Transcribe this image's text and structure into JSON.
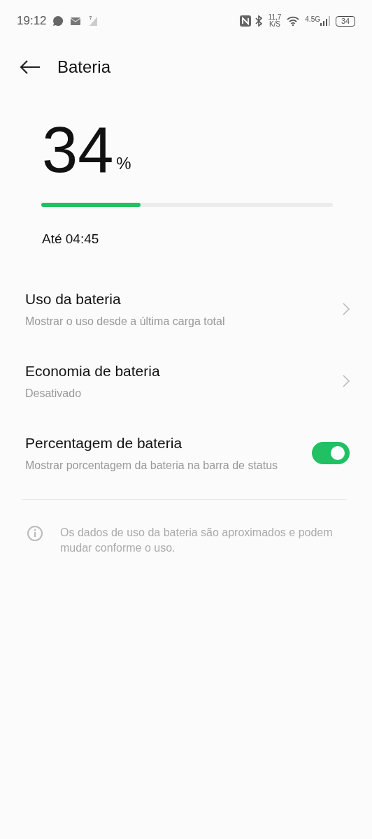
{
  "status_bar": {
    "time": "19:12",
    "speed": "11,7",
    "speed_unit": "K/S",
    "network": "4.5G",
    "battery": "34"
  },
  "header": {
    "title": "Bateria"
  },
  "battery": {
    "value": "34",
    "unit": "%",
    "level": 0.34,
    "until": "Até 04:45"
  },
  "settings": [
    {
      "kind": "link",
      "title": "Uso da bateria",
      "subtitle": "Mostrar o uso desde a última carga total"
    },
    {
      "kind": "link",
      "title": "Economia de bateria",
      "subtitle": "Desativado"
    },
    {
      "kind": "toggle",
      "title": "Percentagem de bateria",
      "subtitle": "Mostrar porcentagem da bateria na barra de status",
      "on": true
    }
  ],
  "note": "Os dados de uso da bateria são aproximados e podem mudar conforme o uso."
}
